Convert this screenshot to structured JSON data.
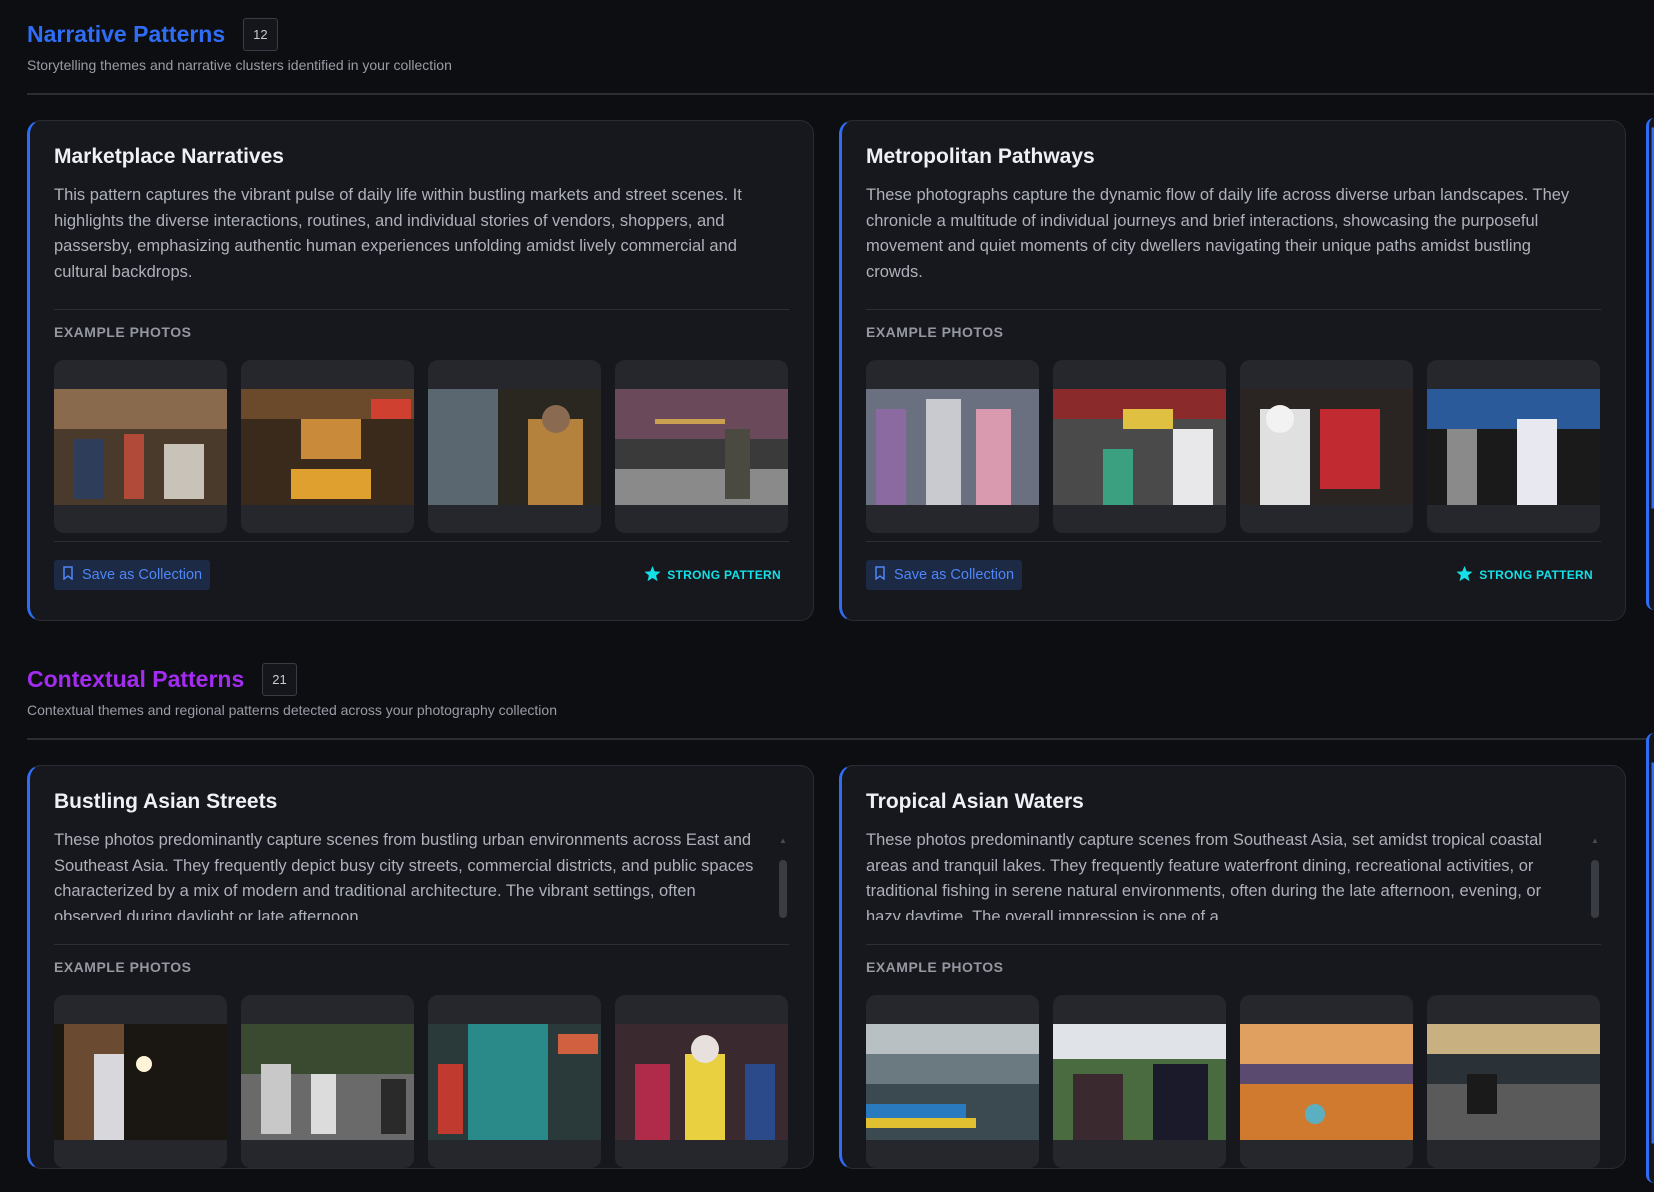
{
  "colors": {
    "narrative_accent": "#2f6df6",
    "contextual_accent": "#a32cf0",
    "strong": "#14e0e8"
  },
  "narrative": {
    "title": "Narrative Patterns",
    "count": "12",
    "subtitle": "Storytelling themes and narrative clusters identified in your collection",
    "cards": [
      {
        "title": "Marketplace Narratives",
        "description": "This pattern captures the vibrant pulse of daily life within bustling markets and street scenes. It highlights the diverse interactions, routines, and individual stories of vendors, shoppers, and passersby, emphasizing authentic human experiences unfolding amidst lively commercial and cultural backdrops.",
        "examples_label": "EXAMPLE PHOTOS",
        "save_label": "Save as Collection",
        "strength_label": "STRONG PATTERN"
      },
      {
        "title": "Metropolitan Pathways",
        "description": "These photographs capture the dynamic flow of daily life across diverse urban landscapes. They chronicle a multitude of individual journeys and brief interactions, showcasing the purposeful movement and quiet moments of city dwellers navigating their unique paths amidst bustling crowds.",
        "examples_label": "EXAMPLE PHOTOS",
        "save_label": "Save as Collection",
        "strength_label": "STRONG PATTERN"
      }
    ]
  },
  "contextual": {
    "title": "Contextual Patterns",
    "count": "21",
    "subtitle": "Contextual themes and regional patterns detected across your photography collection",
    "cards": [
      {
        "title": "Bustling Asian Streets",
        "description": "These photos predominantly capture scenes from bustling urban environments across East and Southeast Asia. They frequently depict busy city streets, commercial districts, and public spaces characterized by a mix of modern and traditional architecture. The vibrant settings, often observed during daylight or late afternoon,",
        "examples_label": "EXAMPLE PHOTOS"
      },
      {
        "title": "Tropical Asian Waters",
        "description": "These photos predominantly capture scenes from Southeast Asia, set amidst tropical coastal areas and tranquil lakes. They frequently feature waterfront dining, recreational activities, or traditional fishing in serene natural environments, often during the late afternoon, evening, or hazy daytime. The overall impression is one of a",
        "examples_label": "EXAMPLE PHOTOS"
      }
    ]
  }
}
